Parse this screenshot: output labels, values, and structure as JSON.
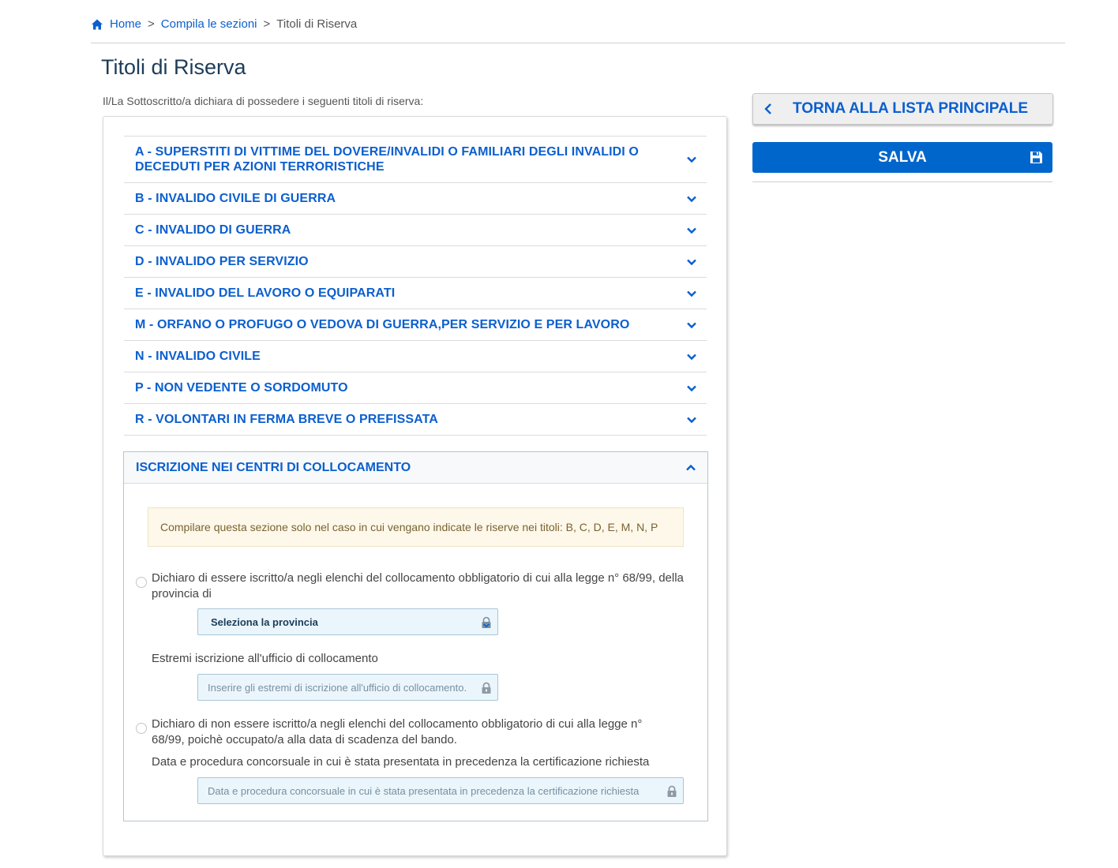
{
  "breadcrumb": {
    "home": "Home",
    "section": "Compila le sezioni",
    "current": "Titoli di Riserva",
    "separator": ">"
  },
  "page": {
    "title": "Titoli di Riserva",
    "subtitle": "Il/La Sottoscritto/a dichiara di possedere i seguenti titoli di riserva:"
  },
  "accordion": {
    "items": [
      {
        "label": "A - SUPERSTITI DI VITTIME DEL DOVERE/INVALIDI O FAMILIARI DEGLI INVALIDI O DECEDUTI PER AZIONI TERRORISTICHE"
      },
      {
        "label": "B - INVALIDO CIVILE DI GUERRA"
      },
      {
        "label": "C - INVALIDO DI GUERRA"
      },
      {
        "label": "D - INVALIDO PER SERVIZIO"
      },
      {
        "label": "E - INVALIDO DEL LAVORO O EQUIPARATI"
      },
      {
        "label": "M - ORFANO O PROFUGO O VEDOVA DI GUERRA,PER SERVIZIO E PER LAVORO"
      },
      {
        "label": "N - INVALIDO CIVILE"
      },
      {
        "label": "P - NON VEDENTE O SORDOMUTO"
      },
      {
        "label": "R - VOLONTARI IN FERMA BREVE O PREFISSATA"
      }
    ]
  },
  "collocamento": {
    "title": "ISCRIZIONE NEI CENTRI DI COLLOCAMENTO",
    "alert": "Compilare questa sezione solo nel caso in cui vengano indicate le riserve nei titoli: B, C, D, E, M, N, P",
    "option1_text": "Dichiaro di essere iscritto/a negli elenchi del collocamento obbligatorio di cui alla legge n° 68/99, della provincia di",
    "province_select": "Seleziona la provincia",
    "estremi_label": "Estremi iscrizione all'ufficio di collocamento",
    "estremi_placeholder": "Inserire gli estremi di iscrizione all'ufficio di collocamento.",
    "option2_text": "Dichiaro di non essere iscritto/a negli elenchi del collocamento obbligatorio di cui alla legge n° 68/99, poichè occupato/a alla data di scadenza del bando.",
    "data_label": "Data e procedura concorsuale in cui è stata presentata in precedenza la certificazione richiesta",
    "data_placeholder": "Data e procedura concorsuale in cui è stata presentata in precedenza la certificazione richiesta"
  },
  "actions": {
    "back_label": "TORNA ALLA LISTA PRINCIPALE",
    "save_label": "SALVA"
  },
  "colors": {
    "accent": "#0b5fcf",
    "save_button": "#0066cc",
    "title": "#1d3c5a",
    "alert_bg": "#fdf8ea"
  },
  "icons": [
    "home-icon",
    "chevron-down-icon",
    "chevron-up-icon",
    "chevron-left-icon",
    "floppy-disk-icon",
    "lock-icon",
    "select-lock-icon"
  ]
}
